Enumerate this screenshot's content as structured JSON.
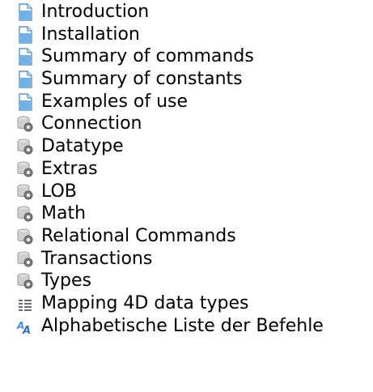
{
  "toc": {
    "items": [
      {
        "label": "Introduction",
        "icon": "document-icon"
      },
      {
        "label": "Installation",
        "icon": "document-icon"
      },
      {
        "label": "Summary of commands",
        "icon": "document-icon"
      },
      {
        "label": "Summary of constants",
        "icon": "document-icon"
      },
      {
        "label": "Examples of use",
        "icon": "document-icon"
      },
      {
        "label": "Connection",
        "icon": "command-theme-icon"
      },
      {
        "label": "Datatype",
        "icon": "command-theme-icon"
      },
      {
        "label": "Extras",
        "icon": "command-theme-icon"
      },
      {
        "label": "LOB",
        "icon": "command-theme-icon"
      },
      {
        "label": "Math",
        "icon": "command-theme-icon"
      },
      {
        "label": "Relational Commands",
        "icon": "command-theme-icon"
      },
      {
        "label": "Transactions",
        "icon": "command-theme-icon"
      },
      {
        "label": "Types",
        "icon": "command-theme-icon"
      },
      {
        "label": "Mapping 4D data types",
        "icon": "table-icon"
      },
      {
        "label": "Alphabetische Liste der Befehle",
        "icon": "alphabetical-list-icon"
      }
    ]
  },
  "colors": {
    "document_blue": "#6fb2e8",
    "document_border": "#3a7fc4",
    "gear_gray": "#8a8a8a",
    "db_gray": "#c9c9c9",
    "text": "#000000"
  }
}
